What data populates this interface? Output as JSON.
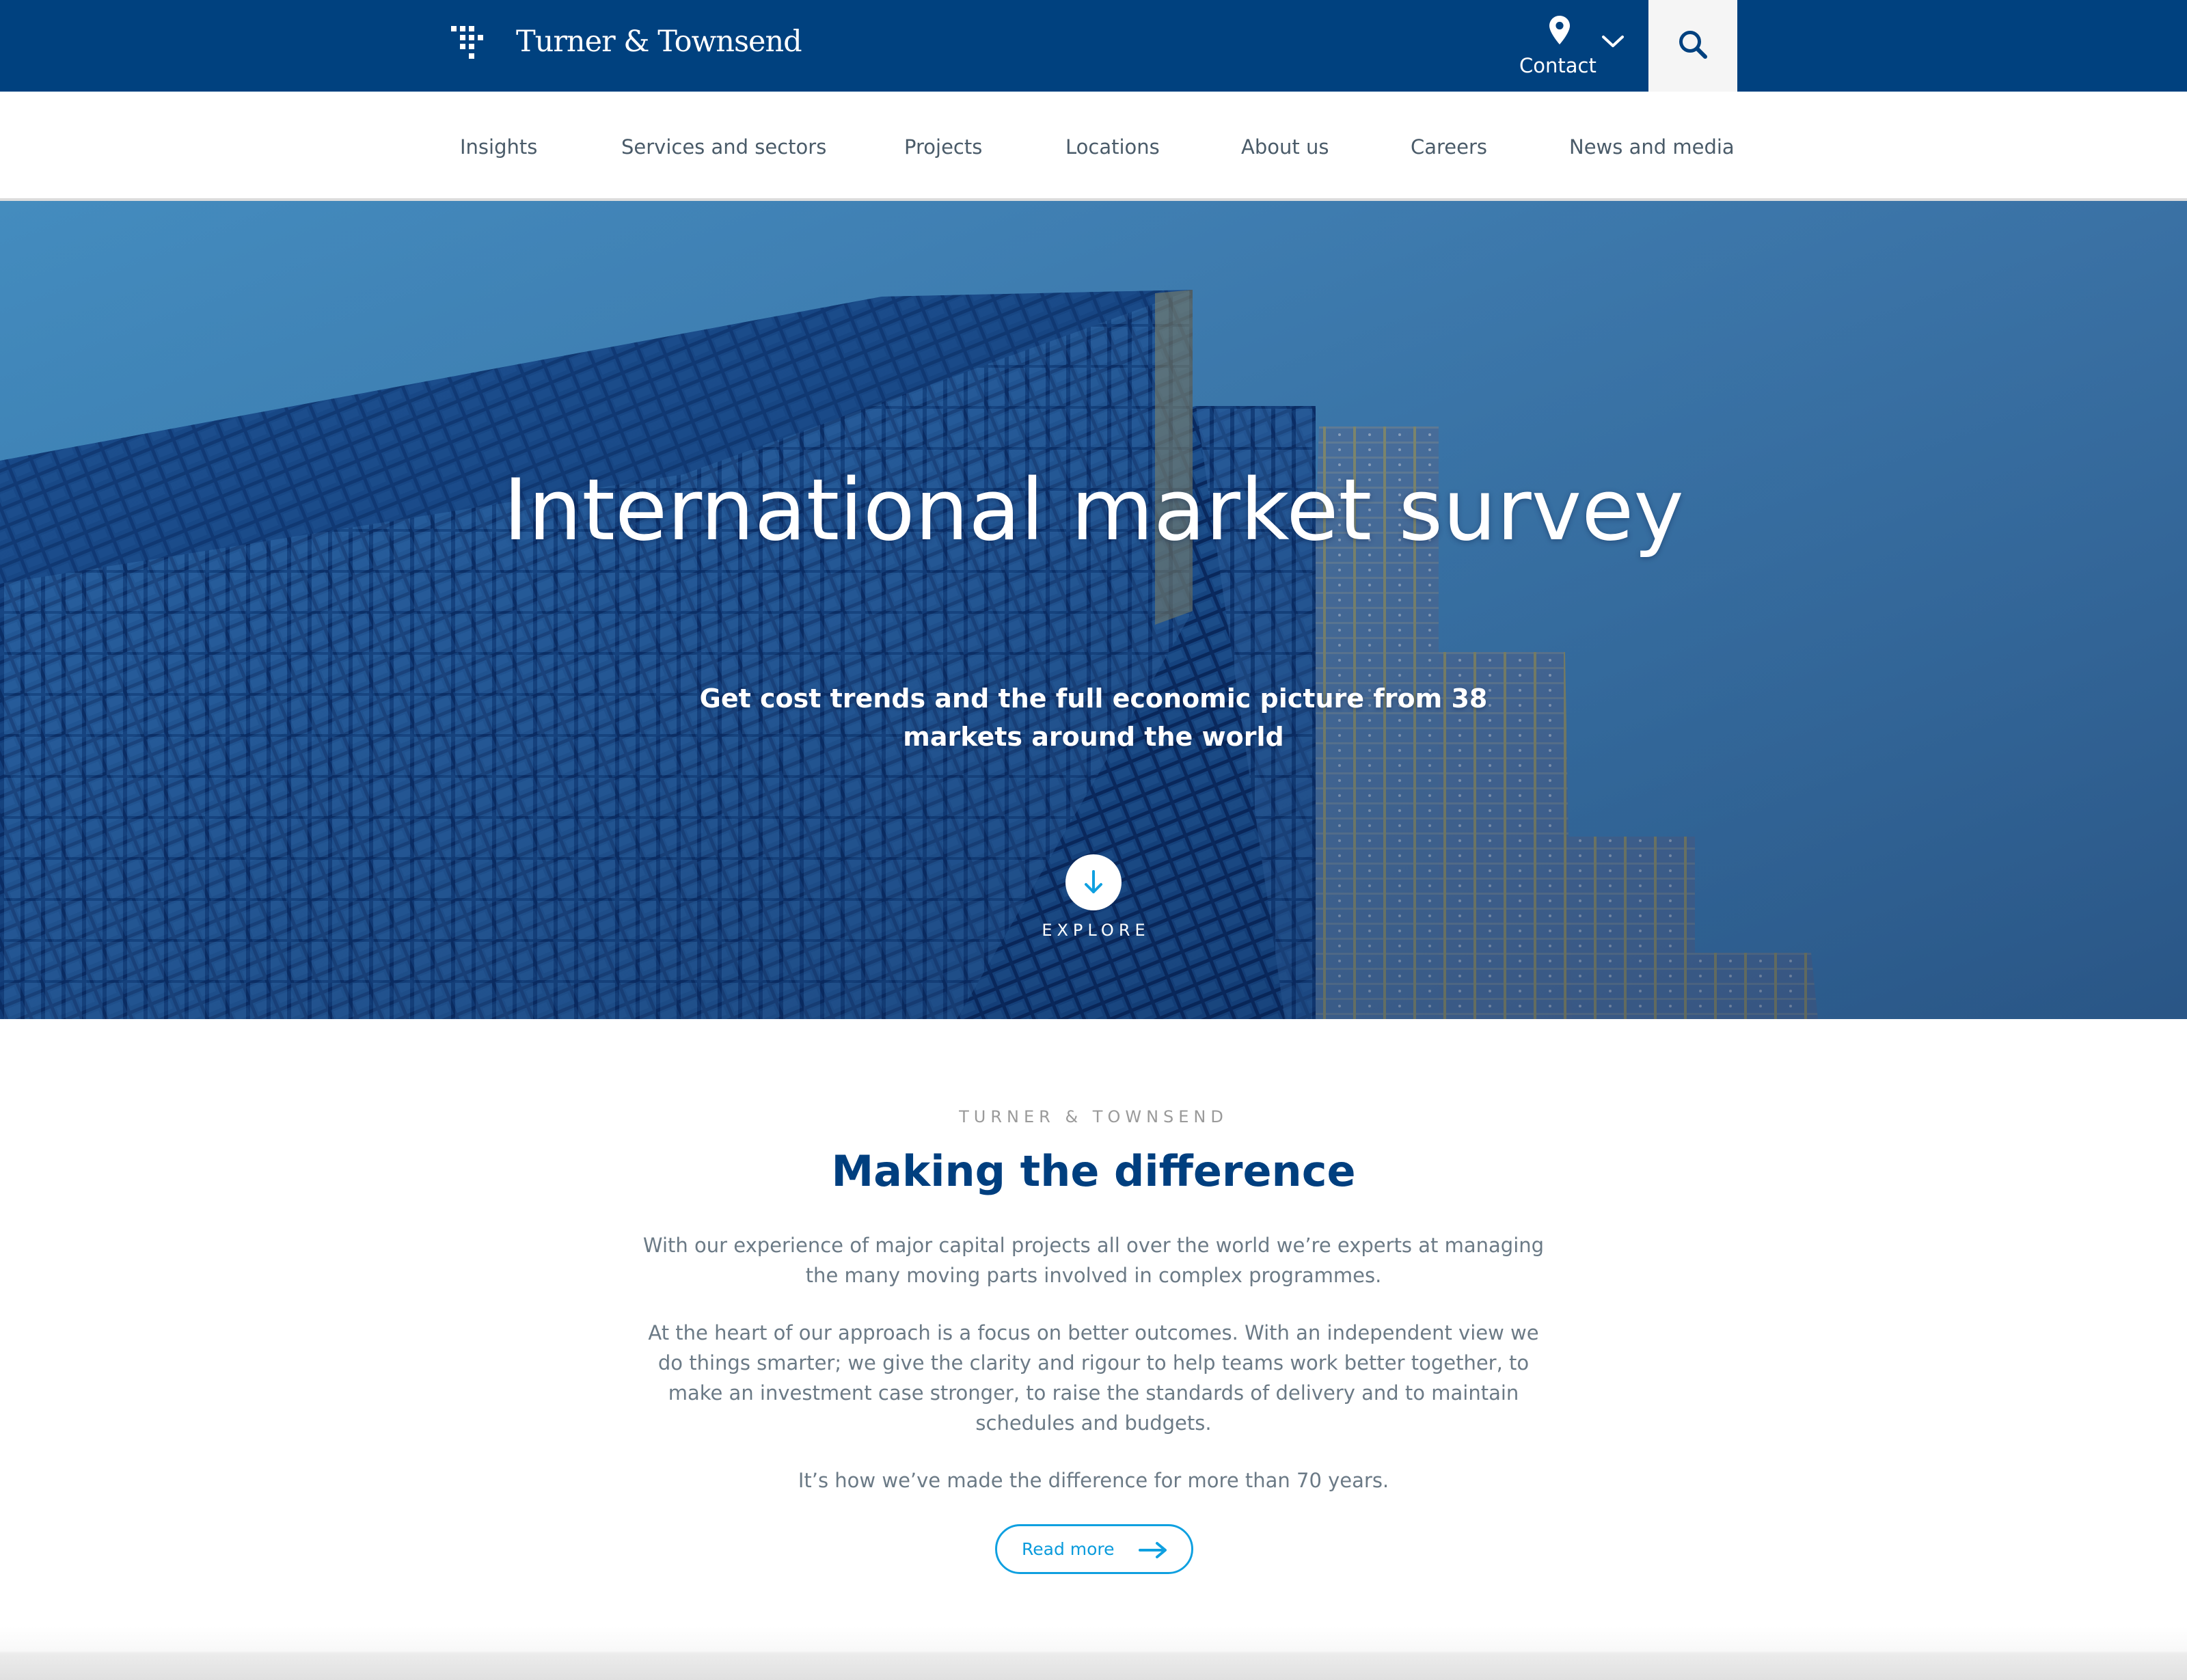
{
  "header": {
    "brand": "Turner & Townsend",
    "contact_label": "Contact",
    "icons": {
      "logo": "dot-matrix-logo-icon",
      "contact": "location-pin-icon",
      "contact_toggle": "chevron-down-icon",
      "search": "search-icon"
    },
    "colors": {
      "bar": "#00417f",
      "search_bg": "#f5f5f5"
    }
  },
  "nav": {
    "items": [
      {
        "label": "Insights"
      },
      {
        "label": "Services and sectors"
      },
      {
        "label": "Projects"
      },
      {
        "label": "Locations"
      },
      {
        "label": "About us"
      },
      {
        "label": "Careers"
      },
      {
        "label": "News and media"
      }
    ]
  },
  "hero": {
    "title": "International market survey",
    "subtitle": "Get cost trends and the full economic picture from 38 markets around the world",
    "explore_label": "EXPLORE",
    "explore_icon": "arrow-down-icon",
    "background": "glass-skyscraper-against-blue-sky-image"
  },
  "intro": {
    "eyebrow": "TURNER & TOWNSEND",
    "heading": "Making the difference",
    "paragraphs": [
      "With our experience of major capital projects all over the world we’re experts at managing the many moving parts involved in complex programmes.",
      "At the heart of our approach is a focus on better outcomes. With an independent view we do things smarter; we give the clarity and rigour to help teams work better together, to make an investment case stronger, to raise the standards of delivery and to maintain schedules and budgets.",
      "It’s how we’ve made the difference for more than 70 years."
    ],
    "read_more_label": "Read more",
    "read_more_icon": "arrow-right-icon",
    "colors": {
      "heading": "#003f7f",
      "accent": "#0fa0e0",
      "body": "#6b7a86"
    }
  }
}
